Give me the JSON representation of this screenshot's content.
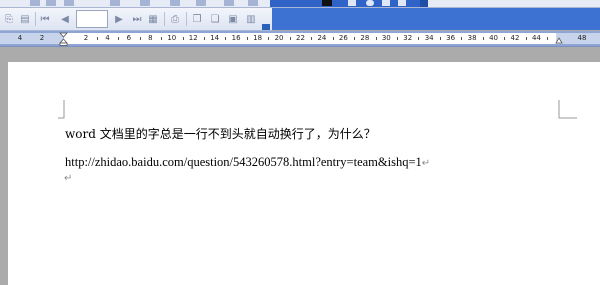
{
  "toolbar": {
    "page_field_value": ""
  },
  "ruler": {
    "left_labels": [
      "4",
      "2"
    ],
    "labels": [
      "2",
      "4",
      "6",
      "8",
      "10",
      "12",
      "14",
      "16",
      "18",
      "20",
      "22",
      "24",
      "26",
      "28",
      "30",
      "32",
      "34",
      "36",
      "38",
      "40",
      "42",
      "44",
      "48"
    ]
  },
  "document": {
    "line1": "word 文档里的字总是一行不到头就自动换行了，为什么？",
    "line2": "http://zhidao.baidu.com/question/543260578.html?entry=team&ishq=1",
    "para_mark": "↵"
  }
}
